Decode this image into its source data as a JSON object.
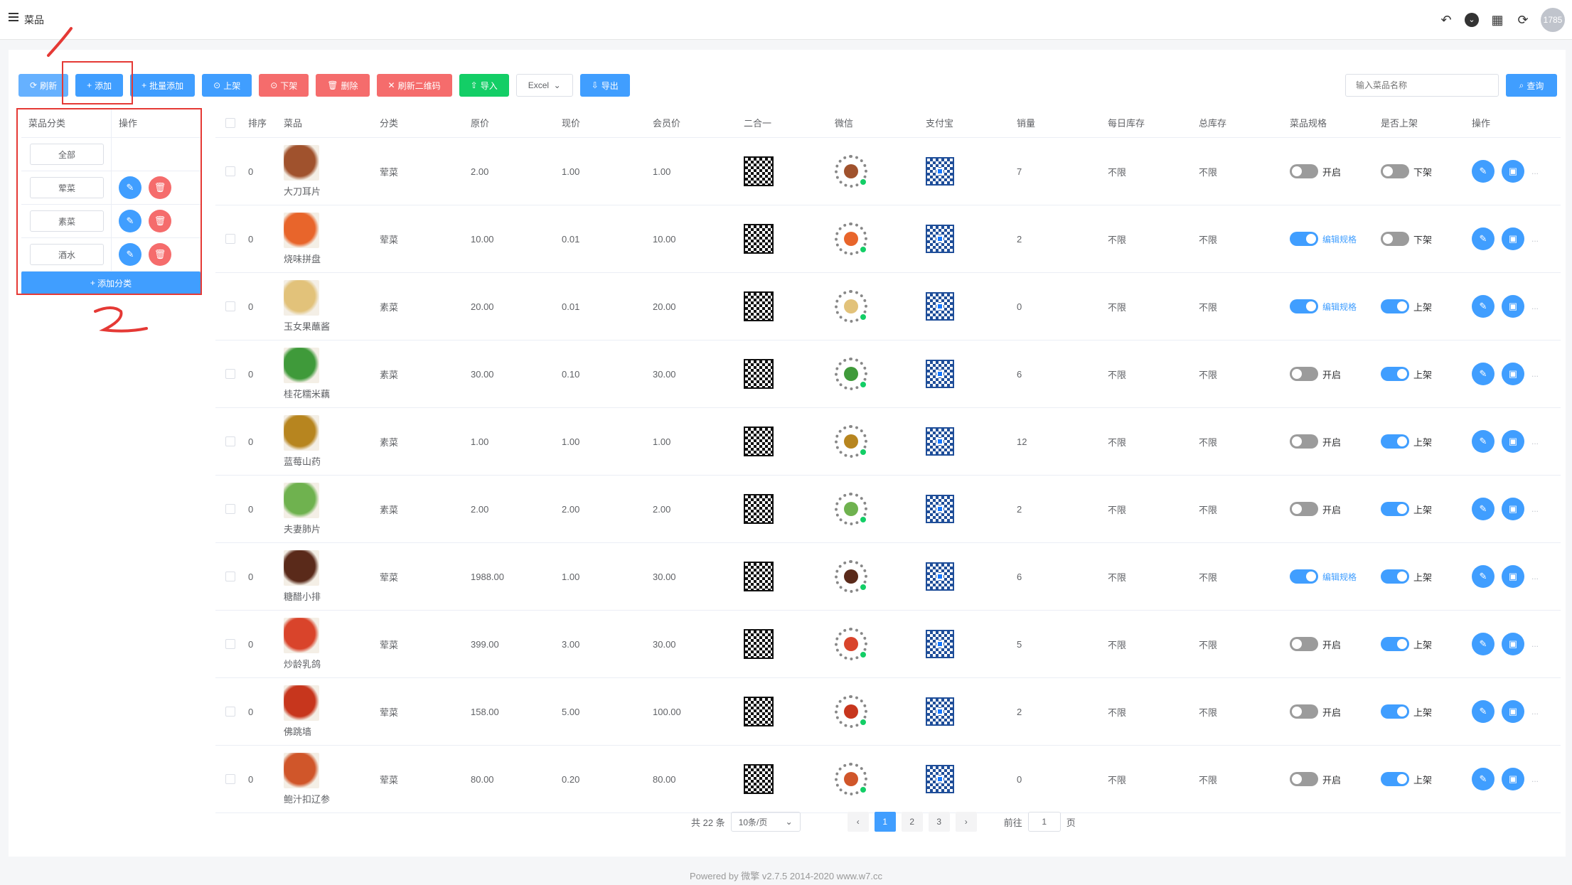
{
  "header": {
    "title": "菜品",
    "avatar_text": "1785"
  },
  "toolbar": {
    "refresh": "刷新",
    "add": "添加",
    "batch_add": "批量添加",
    "on_shelf": "上架",
    "off_shelf": "下架",
    "delete": "删除",
    "refresh_qr": "刷新二维码",
    "import": "导入",
    "excel": "Excel",
    "export": "导出",
    "search_placeholder": "输入菜品名称",
    "query": "查询"
  },
  "category_table": {
    "headers": [
      "菜品分类",
      "操作"
    ],
    "rows": [
      {
        "name": "全部"
      },
      {
        "name": "荤菜"
      },
      {
        "name": "素菜"
      },
      {
        "name": "酒水"
      }
    ],
    "add_label": "添加分类"
  },
  "dish_table": {
    "headers": [
      "排序",
      "菜品",
      "分类",
      "原价",
      "现价",
      "会员价",
      "二合一",
      "微信",
      "支付宝",
      "销量",
      "每日库存",
      "总库存",
      "菜品规格",
      "是否上架",
      "操作"
    ],
    "rows": [
      {
        "sort": "0",
        "name": "大刀耳片",
        "category": "荤菜",
        "original": "2.00",
        "current": "1.00",
        "member": "1.00",
        "sales": "7",
        "daily": "不限",
        "total": "不限",
        "spec_on": false,
        "spec_label": "开启",
        "shelf_on": false,
        "shelf_label": "下架",
        "img": "#a0522d"
      },
      {
        "sort": "0",
        "name": "烧味拼盘",
        "category": "荤菜",
        "original": "10.00",
        "current": "0.01",
        "member": "10.00",
        "sales": "2",
        "daily": "不限",
        "total": "不限",
        "spec_on": true,
        "spec_label": "编辑规格",
        "shelf_on": false,
        "shelf_label": "下架",
        "img": "#e8652b"
      },
      {
        "sort": "0",
        "name": "玉女果蘸酱",
        "category": "素菜",
        "original": "20.00",
        "current": "0.01",
        "member": "20.00",
        "sales": "0",
        "daily": "不限",
        "total": "不限",
        "spec_on": true,
        "spec_label": "编辑规格",
        "shelf_on": true,
        "shelf_label": "上架",
        "img": "#e2c27a"
      },
      {
        "sort": "0",
        "name": "桂花糯米藕",
        "category": "素菜",
        "original": "30.00",
        "current": "0.10",
        "member": "30.00",
        "sales": "6",
        "daily": "不限",
        "total": "不限",
        "spec_on": false,
        "spec_label": "开启",
        "shelf_on": true,
        "shelf_label": "上架",
        "img": "#3f9a3a"
      },
      {
        "sort": "0",
        "name": "蓝莓山药",
        "category": "素菜",
        "original": "1.00",
        "current": "1.00",
        "member": "1.00",
        "sales": "12",
        "daily": "不限",
        "total": "不限",
        "spec_on": false,
        "spec_label": "开启",
        "shelf_on": true,
        "shelf_label": "上架",
        "img": "#b7851f"
      },
      {
        "sort": "0",
        "name": "夫妻肺片",
        "category": "素菜",
        "original": "2.00",
        "current": "2.00",
        "member": "2.00",
        "sales": "2",
        "daily": "不限",
        "total": "不限",
        "spec_on": false,
        "spec_label": "开启",
        "shelf_on": true,
        "shelf_label": "上架",
        "img": "#6fb24f"
      },
      {
        "sort": "0",
        "name": "糖醋小排",
        "category": "荤菜",
        "original": "1988.00",
        "current": "1.00",
        "member": "30.00",
        "sales": "6",
        "daily": "不限",
        "total": "不限",
        "spec_on": true,
        "spec_label": "编辑规格",
        "shelf_on": true,
        "shelf_label": "上架",
        "img": "#5a2a1a"
      },
      {
        "sort": "0",
        "name": "炒龄乳鸽",
        "category": "荤菜",
        "original": "399.00",
        "current": "3.00",
        "member": "30.00",
        "sales": "5",
        "daily": "不限",
        "total": "不限",
        "spec_on": false,
        "spec_label": "开启",
        "shelf_on": true,
        "shelf_label": "上架",
        "img": "#d9442b"
      },
      {
        "sort": "0",
        "name": "佛跳墙",
        "category": "荤菜",
        "original": "158.00",
        "current": "5.00",
        "member": "100.00",
        "sales": "2",
        "daily": "不限",
        "total": "不限",
        "spec_on": false,
        "spec_label": "开启",
        "shelf_on": true,
        "shelf_label": "上架",
        "img": "#c7361d"
      },
      {
        "sort": "0",
        "name": "鲍汁扣辽参",
        "category": "荤菜",
        "original": "80.00",
        "current": "0.20",
        "member": "80.00",
        "sales": "0",
        "daily": "不限",
        "total": "不限",
        "spec_on": false,
        "spec_label": "开启",
        "shelf_on": true,
        "shelf_label": "上架",
        "img": "#d0562a"
      }
    ]
  },
  "pagination": {
    "total": "共 22 条",
    "page_size": "10条/页",
    "pages": [
      "1",
      "2",
      "3"
    ],
    "current": "1",
    "goto_label": "前往",
    "goto_value": "1",
    "page_suffix": "页"
  },
  "footer": "Powered by 微擎 v2.7.5 2014-2020 www.w7.cc",
  "colors": {
    "primary": "#409eff",
    "danger": "#f56c6c",
    "success": "#13ce66",
    "annotation": "#e53935"
  }
}
